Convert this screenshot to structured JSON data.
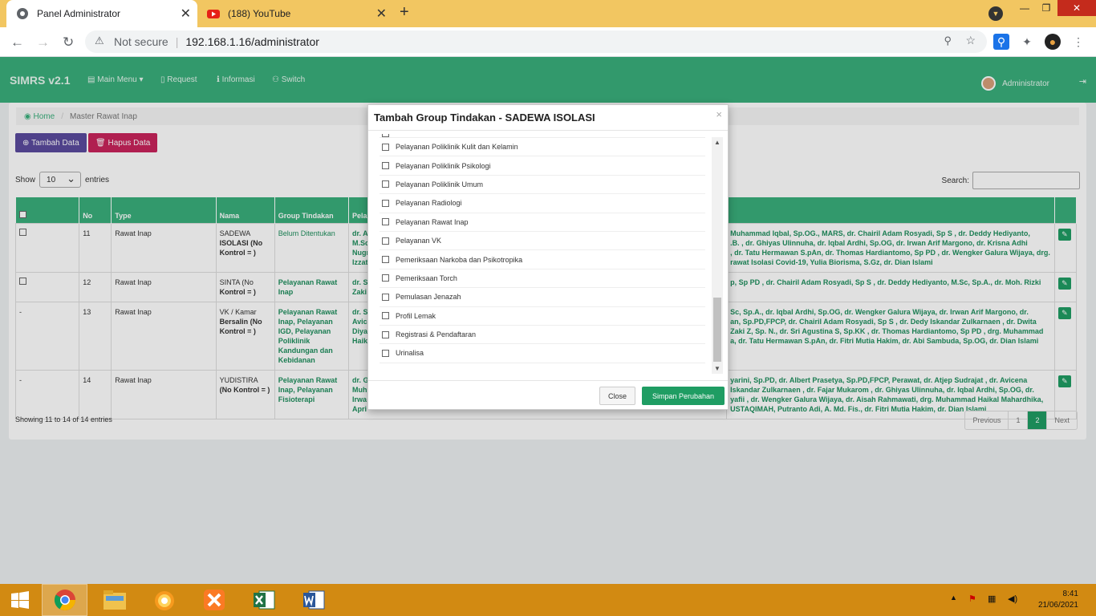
{
  "browser": {
    "tabs": [
      {
        "title": "Panel Administrator"
      },
      {
        "title": "(188) YouTube"
      }
    ],
    "security": "Not secure",
    "url": "192.168.1.16/administrator"
  },
  "app": {
    "brand": "SIMRS v2.1",
    "menu": [
      "Main Menu",
      "Request",
      "Informasi",
      "Switch"
    ],
    "user": "Administrator"
  },
  "breadcrumb": {
    "home": "Home",
    "current": "Master Rawat Inap"
  },
  "toolbar": {
    "add": "Tambah Data",
    "delete": "Hapus Data"
  },
  "length": {
    "show": "Show",
    "value": "10",
    "entries": "entries"
  },
  "search": {
    "label": "Search:"
  },
  "table": {
    "headers": [
      "No",
      "Type",
      "Nama",
      "Group Tindakan",
      "Pela"
    ],
    "rows": [
      {
        "check": true,
        "no": "11",
        "type": "Rawat Inap",
        "nama1": "SADEWA",
        "nama2": "ISOLASI (No Kontrol = )",
        "group": "Belum Ditentukan",
        "left": "dr. A\nM.Sc\nNugr\nIzzat",
        "right": "Muhammad Iqbal, Sp.OG., MARS, dr. Chairil Adam Rosyadi, Sp S , dr. Deddy Hediyanto,\n.B. , dr. Ghiyas Ulinnuha, dr. Iqbal Ardhi, Sp.OG, dr. Irwan Arif Margono, dr. Krisna Adhi\n, dr. Tatu Hermawan S.pAn, dr. Thomas Hardiantomo, Sp PD , dr. Wengker Galura Wijaya, drg.\nrawat Isolasi Covid-19, Yulia Biorisma, S.Gz, dr. Dian Islami"
      },
      {
        "check": true,
        "no": "12",
        "type": "Rawat Inap",
        "nama1": "SINTA (No",
        "nama2": "Kontrol = )",
        "group": "Pelayanan Rawat Inap",
        "left": "dr. S\nZaki",
        "right": "p, Sp PD , dr. Chairil Adam Rosyadi, Sp S , dr. Deddy Hediyanto, M.Sc, Sp.A., dr. Moh. Rizki"
      },
      {
        "check": false,
        "no": "13",
        "type": "Rawat Inap",
        "nama1": "VK / Kamar",
        "nama2": "Bersalin (No Kontrol = )",
        "group": "Pelayanan Rawat Inap, Pelayanan IGD, Pelayanan Poliklinik Kandungan dan Kebidanan",
        "left": "dr. S\nAvic\nDiya\nHaik",
        "right": "Sc, Sp.A., dr. Iqbal Ardhi, Sp.OG, dr. Wengker Galura Wijaya, dr. Irwan Arif Margono, dr.\nan, Sp.PD,FPCP, dr. Chairil Adam Rosyadi, Sp S , dr. Dedy Iskandar Zulkarnaen , dr. Dwita\nZaki Z, Sp. N., dr. Sri Agustina S, Sp.KK , dr. Thomas Hardiantomo, Sp PD , drg. Muhammad\na, dr. Tatu Hermawan S.pAn, dr. Fitri Mutia Hakim, dr. Abi Sambuda, Sp.OG, dr. Dian Islami"
      },
      {
        "check": false,
        "no": "14",
        "type": "Rawat Inap",
        "nama1": "YUDISTIRA",
        "nama2": "(No Kontrol = )",
        "group": "Pelayanan Rawat Inap, Pelayanan Fisioterapi",
        "left": "dr. G\nMuh\nIrwa\nApri",
        "right": "yarini, Sp.PD, dr. Albert Prasetya, Sp.PD,FPCP, Perawat, dr. Atjep Sudrajat , dr. Avicena\nIskandar Zulkarnaen , dr. Fajar Mukarom , dr. Ghiyas Ulinnuha, dr. Iqbal Ardhi, Sp.OG, dr.\nyafii , dr. Wengker Galura Wijaya, dr. Aisah Rahmawati, drg. Muhammad Haikal Mahardhika,\nUSTAQIMAH, Putranto Adi, A. Md. Fis., dr. Fitri Mutia Hakim, dr. Dian Islami"
      }
    ]
  },
  "footer": {
    "info": "Showing 11 to 14 of 14 entries",
    "pages": [
      "Previous",
      "1",
      "2",
      "Next"
    ]
  },
  "modal": {
    "title": "Tambah Group Tindakan - SADEWA ISOLASI",
    "items": [
      "Pelayanan Poliklinik Kulit dan Kelamin",
      "Pelayanan Poliklinik Psikologi",
      "Pelayanan Poliklinik Umum",
      "Pelayanan Radiologi",
      "Pelayanan Rawat Inap",
      "Pelayanan VK",
      "Pemeriksaan Narkoba dan Psikotropika",
      "Pemeriksaan Torch",
      "Pemulasan Jenazah",
      "Profil Lemak",
      "Registrasi & Pendaftaran",
      "Urinalisa"
    ],
    "close": "Close",
    "save": "Simpan Perubahan"
  },
  "clock": {
    "time": "8:41",
    "date": "21/06/2021"
  }
}
